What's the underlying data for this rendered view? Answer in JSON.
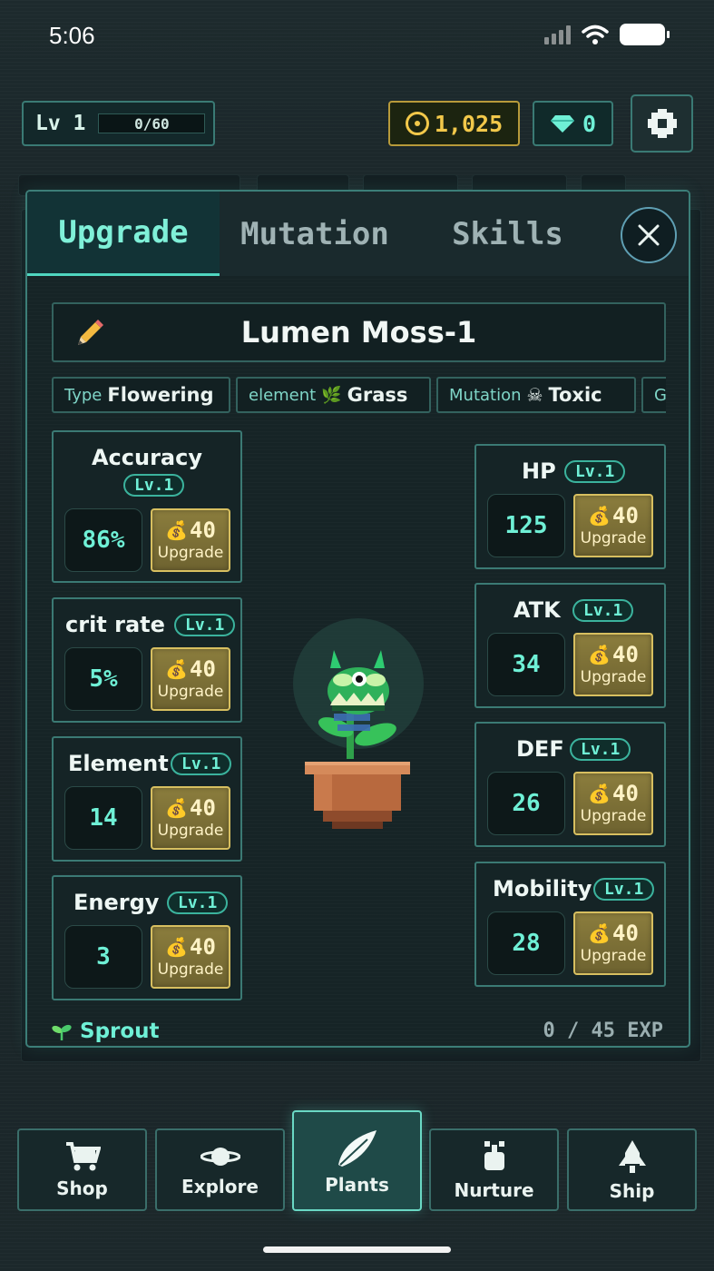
{
  "status_bar": {
    "time": "5:06"
  },
  "hud": {
    "level_label": "Lv 1",
    "xp_text": "0/60",
    "gold": "1,025",
    "gems": "0"
  },
  "tabs": [
    {
      "label": "Upgrade",
      "active": true
    },
    {
      "label": "Mutation",
      "active": false
    },
    {
      "label": "Skills",
      "active": false
    }
  ],
  "plant": {
    "name": "Lumen Moss-1",
    "tags": [
      {
        "key": "Type",
        "value": "Flowering"
      },
      {
        "key": "element",
        "icon": "🌿",
        "value": "Grass"
      },
      {
        "key": "Mutation",
        "icon": "☠",
        "value": "Toxic"
      },
      {
        "key": "G",
        "value": ""
      }
    ]
  },
  "stats_left": [
    {
      "name": "Accuracy",
      "level": "Lv.1",
      "value": "86%",
      "cost": "40",
      "button": "Upgrade"
    },
    {
      "name": "crit rate",
      "level": "Lv.1",
      "value": "5%",
      "cost": "40",
      "button": "Upgrade"
    },
    {
      "name": "Element",
      "level": "Lv.1",
      "value": "14",
      "cost": "40",
      "button": "Upgrade"
    },
    {
      "name": "Energy",
      "level": "Lv.1",
      "value": "3",
      "cost": "40",
      "button": "Upgrade"
    }
  ],
  "stats_right": [
    {
      "name": "HP",
      "level": "Lv.1",
      "value": "125",
      "cost": "40",
      "button": "Upgrade"
    },
    {
      "name": "ATK",
      "level": "Lv.1",
      "value": "34",
      "cost": "40",
      "button": "Upgrade"
    },
    {
      "name": "DEF",
      "level": "Lv.1",
      "value": "26",
      "cost": "40",
      "button": "Upgrade"
    },
    {
      "name": "Mobility",
      "level": "Lv.1",
      "value": "28",
      "cost": "40",
      "button": "Upgrade"
    }
  ],
  "footer": {
    "stage": "Sprout",
    "exp": "0 / 45 EXP"
  },
  "nav": [
    {
      "label": "Shop",
      "icon": "cart-icon"
    },
    {
      "label": "Explore",
      "icon": "planet-icon"
    },
    {
      "label": "Plants",
      "icon": "leaf-icon",
      "active": true
    },
    {
      "label": "Nurture",
      "icon": "sprout-pot-icon"
    },
    {
      "label": "Ship",
      "icon": "rocket-icon"
    }
  ],
  "colors": {
    "accent": "#6ff0d6",
    "gold": "#f2c84a",
    "panel": "#162426",
    "border": "#3c7e78"
  }
}
